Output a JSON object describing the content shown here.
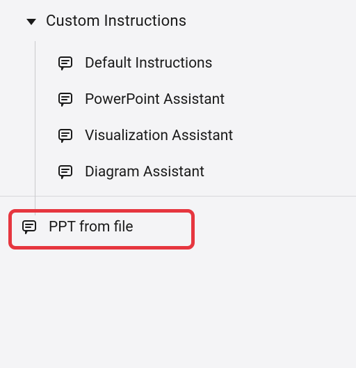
{
  "section": {
    "title": "Custom Instructions",
    "items": [
      {
        "label": "Default Instructions"
      },
      {
        "label": "PowerPoint Assistant"
      },
      {
        "label": "Visualization Assistant"
      },
      {
        "label": "Diagram Assistant"
      }
    ]
  },
  "footer_item": {
    "label": "PPT from file"
  }
}
